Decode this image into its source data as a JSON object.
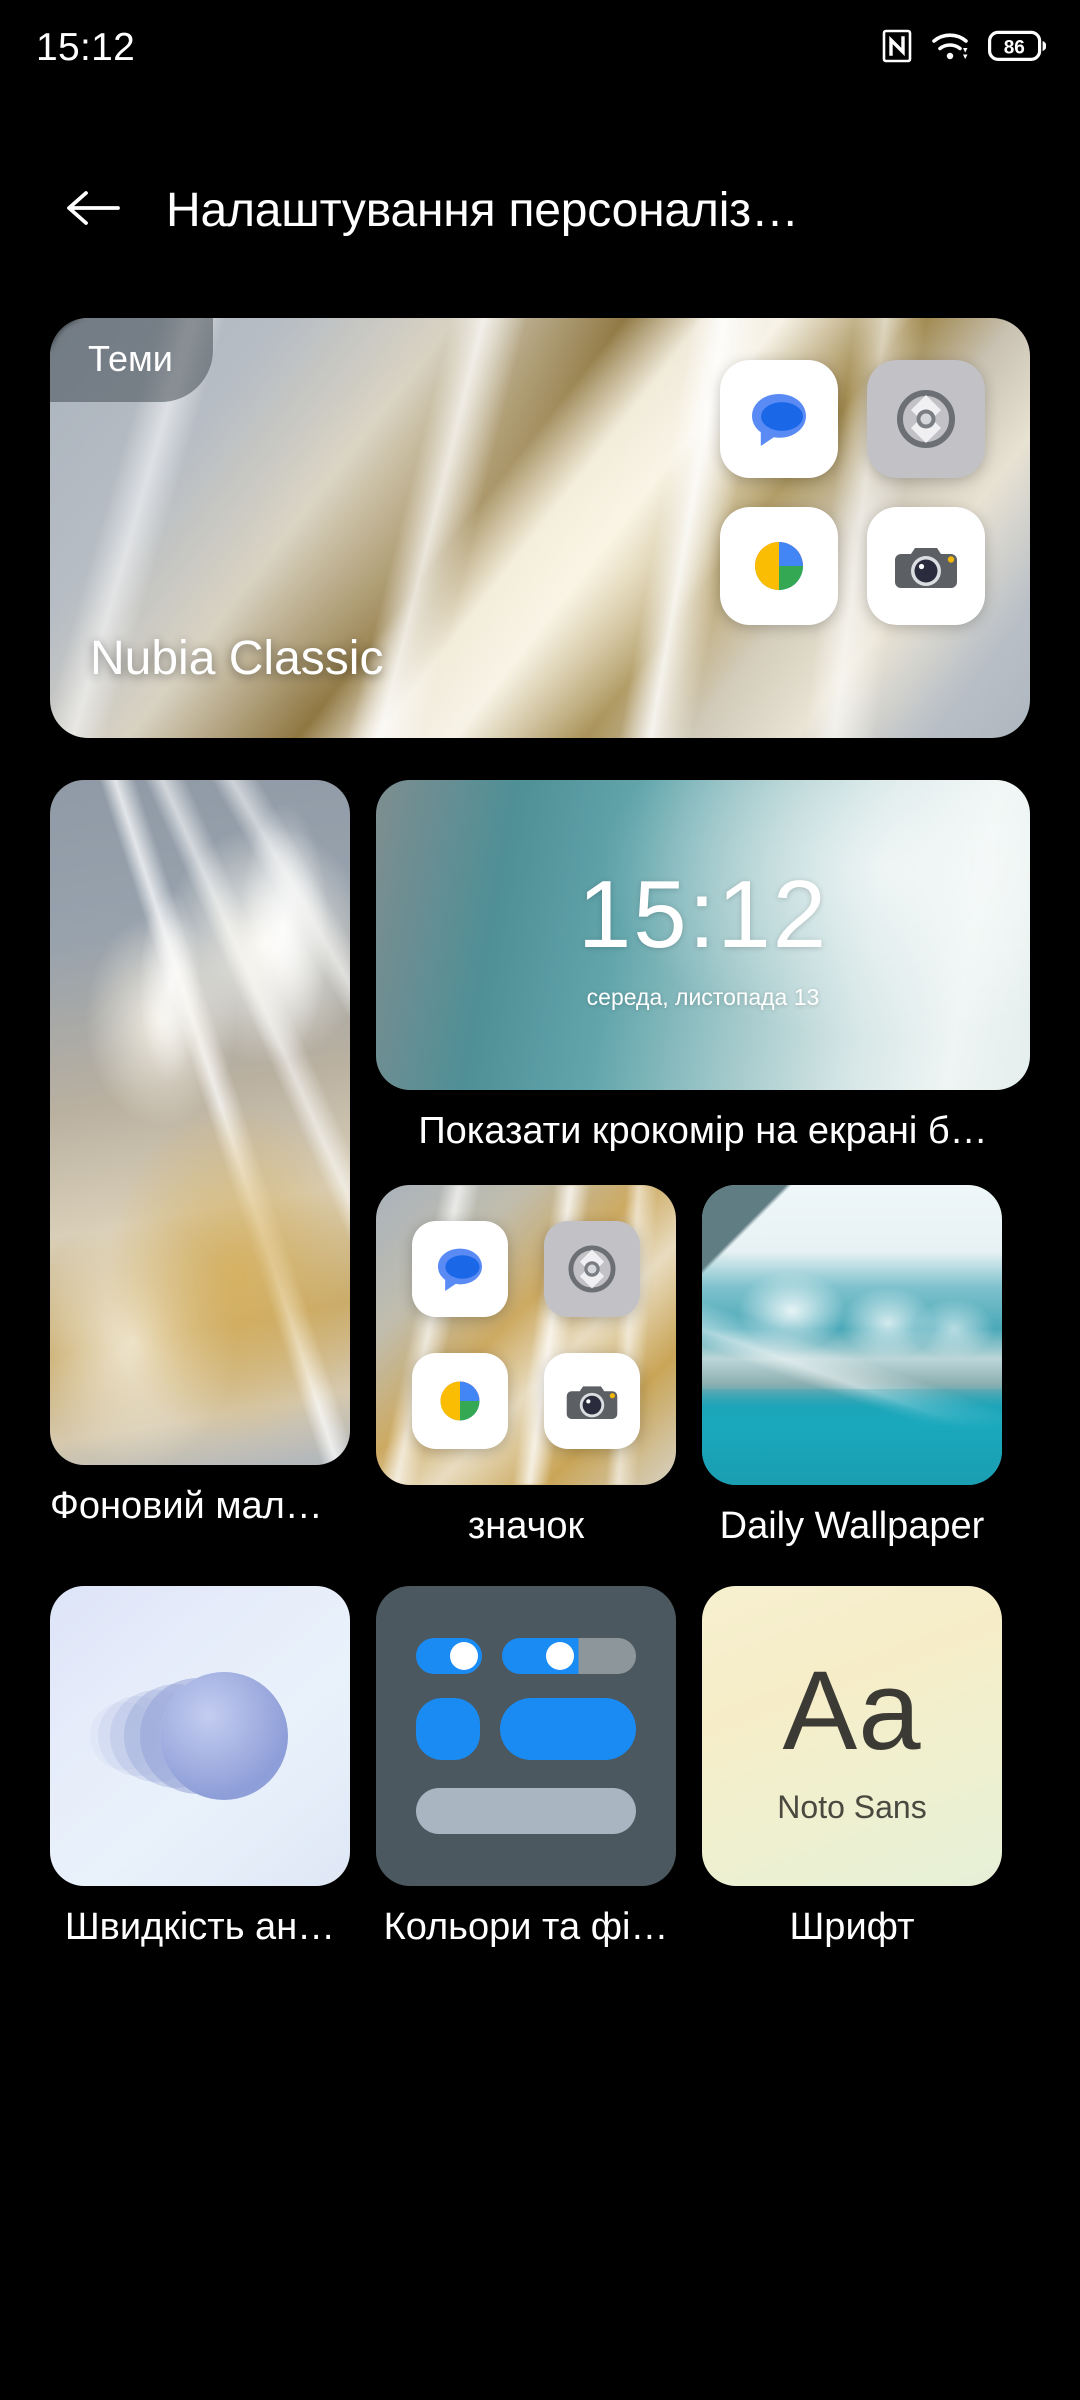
{
  "statusbar": {
    "time": "15:12",
    "icons": [
      {
        "name": "nfc-icon",
        "label": "NFC"
      },
      {
        "name": "wifi-icon",
        "label": "Wi-Fi"
      },
      {
        "name": "battery-icon",
        "label": "Battery"
      }
    ],
    "battery_level": "86"
  },
  "appbar": {
    "back_icon": "back-arrow-icon",
    "title": "Налаштування персоналіз…"
  },
  "themes_card": {
    "badge": "Теми",
    "theme_name": "Nubia Classic",
    "app_icons": [
      {
        "name": "messages-icon",
        "tile": "white"
      },
      {
        "name": "settings-icon",
        "tile": "grey"
      },
      {
        "name": "photos-icon",
        "tile": "white"
      },
      {
        "name": "camera-icon",
        "tile": "white"
      }
    ]
  },
  "wallpaper_card": {
    "label": "Фоновий мал…"
  },
  "clock_card": {
    "time": "15:12",
    "date": "середа, листопада 13",
    "label": "Показати крокомір на екрані б…"
  },
  "icons_card": {
    "label": "значок",
    "app_icons": [
      {
        "name": "messages-icon",
        "tile": "white"
      },
      {
        "name": "settings-icon",
        "tile": "grey"
      },
      {
        "name": "photos-icon",
        "tile": "white"
      },
      {
        "name": "camera-icon",
        "tile": "white"
      }
    ]
  },
  "daily_wallpaper_card": {
    "label": "Daily Wallpaper"
  },
  "animation_card": {
    "label": "Швидкість ан…"
  },
  "colors_card": {
    "label": "Кольори та фі…",
    "accent": "#1a8bf2"
  },
  "font_card": {
    "sample": "Aa",
    "font_name": "Noto Sans",
    "label": "Шрифт"
  }
}
